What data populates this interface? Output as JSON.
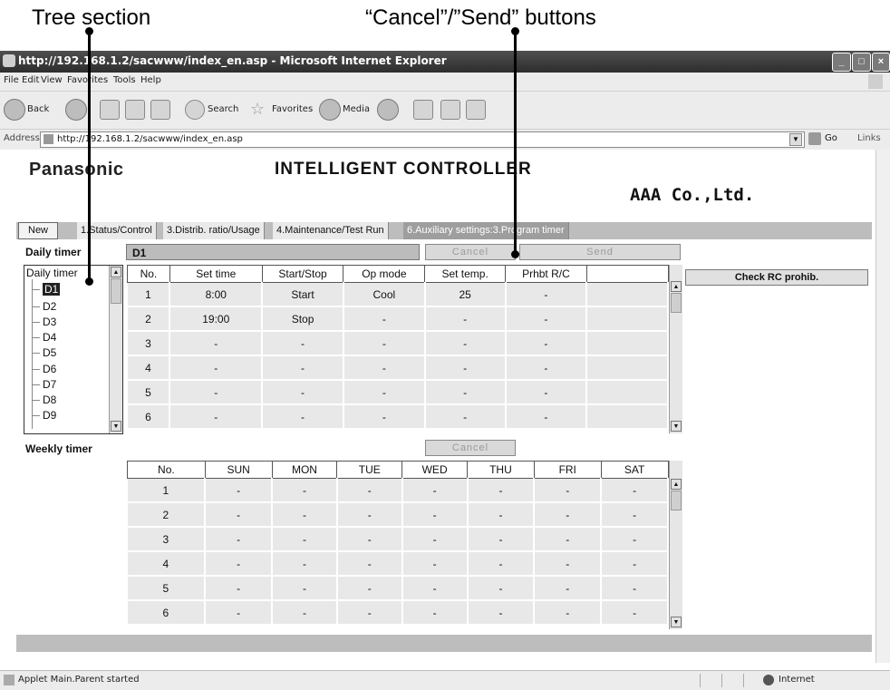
{
  "annotations": {
    "tree_section": "Tree section",
    "buttons": "“Cancel”/”Send” buttons"
  },
  "browser": {
    "title": "http://192.168.1.2/sacwww/index_en.asp - Microsoft Internet Explorer",
    "menu": [
      "File",
      "Edit",
      "View",
      "Favorites",
      "Tools",
      "Help"
    ],
    "toolbar": {
      "back": "Back",
      "search": "Search",
      "favorites": "Favorites",
      "media": "Media"
    },
    "address_label": "Address",
    "address_url": "http://192.168.1.2/sacwww/index_en.asp",
    "go": "Go",
    "links": "Links",
    "status_text": "Applet Main.Parent started",
    "zone": "Internet"
  },
  "app": {
    "logo": "Panasonic",
    "title": "INTELLIGENT CONTROLLER",
    "company": "AAA Co.,Ltd.",
    "tabs": [
      "New",
      "1.Status/Control",
      "3.Distrib. ratio/Usage",
      "4.Maintenance/Test Run",
      "6.Auxiliary settings:3.Program timer"
    ],
    "daily": {
      "label": "Daily timer",
      "selected": "D1",
      "cancel": "Cancel",
      "send": "Send",
      "tree_root": "Daily timer",
      "tree_nodes": [
        "D1",
        "D2",
        "D3",
        "D4",
        "D5",
        "D6",
        "D7",
        "D8",
        "D9"
      ],
      "columns": [
        "No.",
        "Set time",
        "Start/Stop",
        "Op mode",
        "Set temp.",
        "Prhbt R/C",
        ""
      ],
      "rows": [
        [
          "1",
          "8:00",
          "Start",
          "Cool",
          "25",
          "-",
          ""
        ],
        [
          "2",
          "19:00",
          "Stop",
          "-",
          "-",
          "-",
          ""
        ],
        [
          "3",
          "-",
          "-",
          "-",
          "-",
          "-",
          ""
        ],
        [
          "4",
          "-",
          "-",
          "-",
          "-",
          "-",
          ""
        ],
        [
          "5",
          "-",
          "-",
          "-",
          "-",
          "-",
          ""
        ],
        [
          "6",
          "-",
          "-",
          "-",
          "-",
          "-",
          ""
        ]
      ],
      "check_rc": "Check RC prohib."
    },
    "weekly": {
      "label": "Weekly timer",
      "cancel": "Cancel",
      "columns": [
        "No.",
        "SUN",
        "MON",
        "TUE",
        "WED",
        "THU",
        "FRI",
        "SAT"
      ],
      "rows": [
        [
          "1",
          "-",
          "-",
          "-",
          "-",
          "-",
          "-",
          "-"
        ],
        [
          "2",
          "-",
          "-",
          "-",
          "-",
          "-",
          "-",
          "-"
        ],
        [
          "3",
          "-",
          "-",
          "-",
          "-",
          "-",
          "-",
          "-"
        ],
        [
          "4",
          "-",
          "-",
          "-",
          "-",
          "-",
          "-",
          "-"
        ],
        [
          "5",
          "-",
          "-",
          "-",
          "-",
          "-",
          "-",
          "-"
        ],
        [
          "6",
          "-",
          "-",
          "-",
          "-",
          "-",
          "-",
          "-"
        ]
      ]
    }
  }
}
